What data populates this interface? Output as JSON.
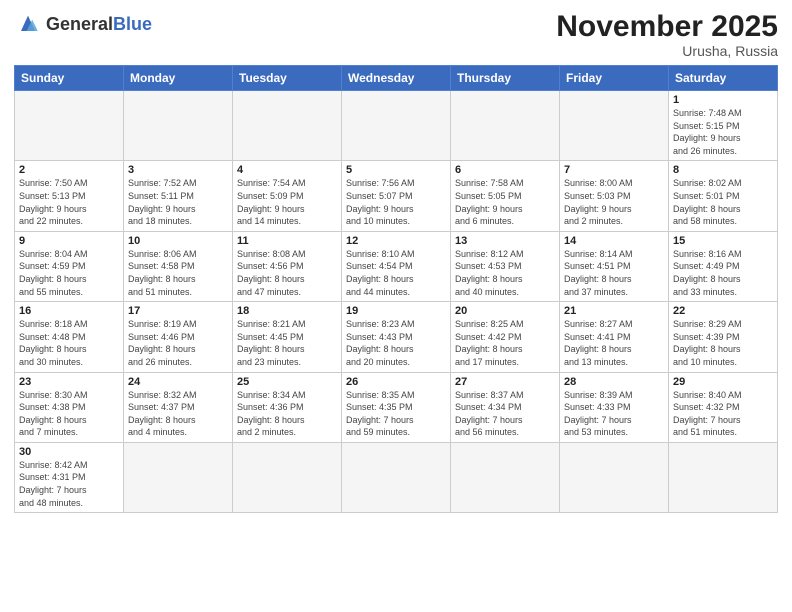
{
  "logo": {
    "text_general": "General",
    "text_blue": "Blue"
  },
  "header": {
    "month": "November 2025",
    "location": "Urusha, Russia"
  },
  "weekdays": [
    "Sunday",
    "Monday",
    "Tuesday",
    "Wednesday",
    "Thursday",
    "Friday",
    "Saturday"
  ],
  "weeks": [
    [
      {
        "day": "",
        "info": ""
      },
      {
        "day": "",
        "info": ""
      },
      {
        "day": "",
        "info": ""
      },
      {
        "day": "",
        "info": ""
      },
      {
        "day": "",
        "info": ""
      },
      {
        "day": "",
        "info": ""
      },
      {
        "day": "1",
        "info": "Sunrise: 7:48 AM\nSunset: 5:15 PM\nDaylight: 9 hours\nand 26 minutes."
      }
    ],
    [
      {
        "day": "2",
        "info": "Sunrise: 7:50 AM\nSunset: 5:13 PM\nDaylight: 9 hours\nand 22 minutes."
      },
      {
        "day": "3",
        "info": "Sunrise: 7:52 AM\nSunset: 5:11 PM\nDaylight: 9 hours\nand 18 minutes."
      },
      {
        "day": "4",
        "info": "Sunrise: 7:54 AM\nSunset: 5:09 PM\nDaylight: 9 hours\nand 14 minutes."
      },
      {
        "day": "5",
        "info": "Sunrise: 7:56 AM\nSunset: 5:07 PM\nDaylight: 9 hours\nand 10 minutes."
      },
      {
        "day": "6",
        "info": "Sunrise: 7:58 AM\nSunset: 5:05 PM\nDaylight: 9 hours\nand 6 minutes."
      },
      {
        "day": "7",
        "info": "Sunrise: 8:00 AM\nSunset: 5:03 PM\nDaylight: 9 hours\nand 2 minutes."
      },
      {
        "day": "8",
        "info": "Sunrise: 8:02 AM\nSunset: 5:01 PM\nDaylight: 8 hours\nand 58 minutes."
      }
    ],
    [
      {
        "day": "9",
        "info": "Sunrise: 8:04 AM\nSunset: 4:59 PM\nDaylight: 8 hours\nand 55 minutes."
      },
      {
        "day": "10",
        "info": "Sunrise: 8:06 AM\nSunset: 4:58 PM\nDaylight: 8 hours\nand 51 minutes."
      },
      {
        "day": "11",
        "info": "Sunrise: 8:08 AM\nSunset: 4:56 PM\nDaylight: 8 hours\nand 47 minutes."
      },
      {
        "day": "12",
        "info": "Sunrise: 8:10 AM\nSunset: 4:54 PM\nDaylight: 8 hours\nand 44 minutes."
      },
      {
        "day": "13",
        "info": "Sunrise: 8:12 AM\nSunset: 4:53 PM\nDaylight: 8 hours\nand 40 minutes."
      },
      {
        "day": "14",
        "info": "Sunrise: 8:14 AM\nSunset: 4:51 PM\nDaylight: 8 hours\nand 37 minutes."
      },
      {
        "day": "15",
        "info": "Sunrise: 8:16 AM\nSunset: 4:49 PM\nDaylight: 8 hours\nand 33 minutes."
      }
    ],
    [
      {
        "day": "16",
        "info": "Sunrise: 8:18 AM\nSunset: 4:48 PM\nDaylight: 8 hours\nand 30 minutes."
      },
      {
        "day": "17",
        "info": "Sunrise: 8:19 AM\nSunset: 4:46 PM\nDaylight: 8 hours\nand 26 minutes."
      },
      {
        "day": "18",
        "info": "Sunrise: 8:21 AM\nSunset: 4:45 PM\nDaylight: 8 hours\nand 23 minutes."
      },
      {
        "day": "19",
        "info": "Sunrise: 8:23 AM\nSunset: 4:43 PM\nDaylight: 8 hours\nand 20 minutes."
      },
      {
        "day": "20",
        "info": "Sunrise: 8:25 AM\nSunset: 4:42 PM\nDaylight: 8 hours\nand 17 minutes."
      },
      {
        "day": "21",
        "info": "Sunrise: 8:27 AM\nSunset: 4:41 PM\nDaylight: 8 hours\nand 13 minutes."
      },
      {
        "day": "22",
        "info": "Sunrise: 8:29 AM\nSunset: 4:39 PM\nDaylight: 8 hours\nand 10 minutes."
      }
    ],
    [
      {
        "day": "23",
        "info": "Sunrise: 8:30 AM\nSunset: 4:38 PM\nDaylight: 8 hours\nand 7 minutes."
      },
      {
        "day": "24",
        "info": "Sunrise: 8:32 AM\nSunset: 4:37 PM\nDaylight: 8 hours\nand 4 minutes."
      },
      {
        "day": "25",
        "info": "Sunrise: 8:34 AM\nSunset: 4:36 PM\nDaylight: 8 hours\nand 2 minutes."
      },
      {
        "day": "26",
        "info": "Sunrise: 8:35 AM\nSunset: 4:35 PM\nDaylight: 7 hours\nand 59 minutes."
      },
      {
        "day": "27",
        "info": "Sunrise: 8:37 AM\nSunset: 4:34 PM\nDaylight: 7 hours\nand 56 minutes."
      },
      {
        "day": "28",
        "info": "Sunrise: 8:39 AM\nSunset: 4:33 PM\nDaylight: 7 hours\nand 53 minutes."
      },
      {
        "day": "29",
        "info": "Sunrise: 8:40 AM\nSunset: 4:32 PM\nDaylight: 7 hours\nand 51 minutes."
      }
    ],
    [
      {
        "day": "30",
        "info": "Sunrise: 8:42 AM\nSunset: 4:31 PM\nDaylight: 7 hours\nand 48 minutes.",
        "has_data": true
      },
      {
        "day": "",
        "info": ""
      },
      {
        "day": "",
        "info": ""
      },
      {
        "day": "",
        "info": ""
      },
      {
        "day": "",
        "info": ""
      },
      {
        "day": "",
        "info": ""
      },
      {
        "day": "",
        "info": ""
      }
    ]
  ]
}
